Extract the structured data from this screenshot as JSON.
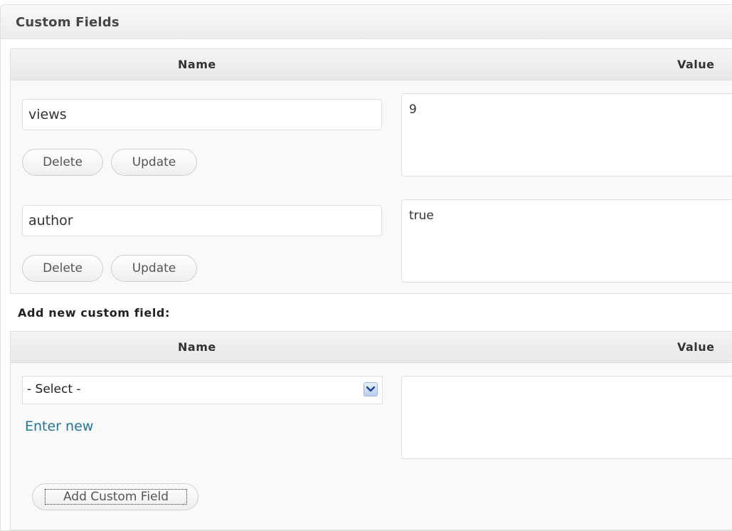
{
  "panel": {
    "title": "Custom Fields"
  },
  "existing_table": {
    "headers": {
      "name": "Name",
      "value": "Value"
    },
    "rows": [
      {
        "name": "views",
        "value": "9",
        "delete_label": "Delete",
        "update_label": "Update"
      },
      {
        "name": "author",
        "value": "true",
        "delete_label": "Delete",
        "update_label": "Update"
      }
    ]
  },
  "add_new": {
    "label": "Add new custom field:",
    "headers": {
      "name": "Name",
      "value": "Value"
    },
    "select": {
      "selected": "- Select -"
    },
    "enter_new_label": "Enter new",
    "value": "",
    "submit_label": "Add Custom Field"
  },
  "colors": {
    "link": "#21759b",
    "header_bg": "#ececec",
    "border": "#dfdfdf"
  }
}
